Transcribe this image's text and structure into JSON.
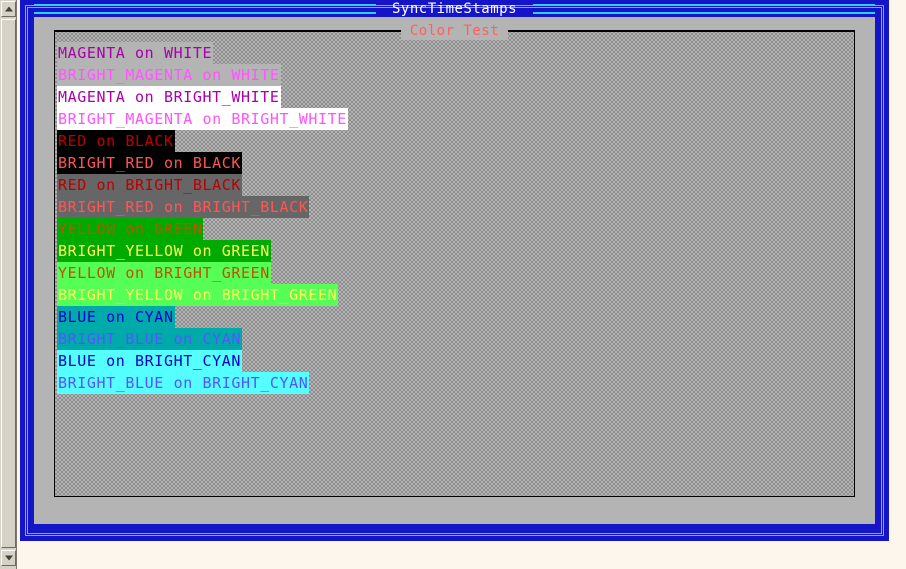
{
  "window": {
    "title": "SyncTimeStamps",
    "frame_color": "#1414c8",
    "rule_color": "#2fd0f0",
    "client_color": "#b4b4b4",
    "desktop_color": "#fdf6ec"
  },
  "scrollbar": {
    "up_icon": "triangle-up-icon",
    "down_icon": "triangle-down-icon",
    "thumb_label": ""
  },
  "groupbox": {
    "legend": "Color Test",
    "legend_color": "#ff5f5f",
    "border_color": "#000000"
  },
  "palette": {
    "MAGENTA": "#aa00aa",
    "BRIGHT_MAGENTA": "#ff55ff",
    "WHITE": "#b4b4b4",
    "BRIGHT_WHITE": "#ffffff",
    "RED": "#bb0000",
    "BRIGHT_RED": "#ff5555",
    "BLACK": "#000000",
    "BRIGHT_BLACK": "#666666",
    "YELLOW": "#bb5500",
    "BRIGHT_YELLOW": "#ffff55",
    "GREEN": "#00aa00",
    "BRIGHT_GREEN": "#55ff55",
    "BLUE": "#0000cc",
    "BRIGHT_BLUE": "#5555ff",
    "CYAN": "#00aaaa",
    "BRIGHT_CYAN": "#55ffff"
  },
  "color_lines": [
    {
      "text": "MAGENTA on WHITE",
      "fg": "#aa00aa",
      "bg": "#b4b4b4"
    },
    {
      "text": "BRIGHT_MAGENTA on WHITE",
      "fg": "#ff55ff",
      "bg": "#b4b4b4"
    },
    {
      "text": "MAGENTA on BRIGHT_WHITE",
      "fg": "#aa00aa",
      "bg": "#ffffff"
    },
    {
      "text": "BRIGHT_MAGENTA on BRIGHT_WHITE",
      "fg": "#ff55ff",
      "bg": "#ffffff"
    },
    {
      "text": "RED on BLACK",
      "fg": "#bb0000",
      "bg": "#000000"
    },
    {
      "text": "BRIGHT_RED on BLACK",
      "fg": "#ff5555",
      "bg": "#000000"
    },
    {
      "text": "RED on BRIGHT_BLACK",
      "fg": "#bb0000",
      "bg": "#666666"
    },
    {
      "text": "BRIGHT_RED on BRIGHT_BLACK",
      "fg": "#ff5555",
      "bg": "#666666"
    },
    {
      "text": "YELLOW on GREEN",
      "fg": "#bb5500",
      "bg": "#00aa00"
    },
    {
      "text": "BRIGHT_YELLOW on GREEN",
      "fg": "#ffff55",
      "bg": "#00aa00"
    },
    {
      "text": "YELLOW on BRIGHT_GREEN",
      "fg": "#bb5500",
      "bg": "#55ff55"
    },
    {
      "text": "BRIGHT_YELLOW on BRIGHT_GREEN",
      "fg": "#ffff55",
      "bg": "#55ff55"
    },
    {
      "text": "BLUE on CYAN",
      "fg": "#0000cc",
      "bg": "#00aaaa"
    },
    {
      "text": "BRIGHT_BLUE on CYAN",
      "fg": "#5555ff",
      "bg": "#00aaaa"
    },
    {
      "text": "BLUE on BRIGHT_CYAN",
      "fg": "#0000cc",
      "bg": "#55ffff"
    },
    {
      "text": "BRIGHT_BLUE on BRIGHT_CYAN",
      "fg": "#5555ff",
      "bg": "#55ffff"
    }
  ]
}
